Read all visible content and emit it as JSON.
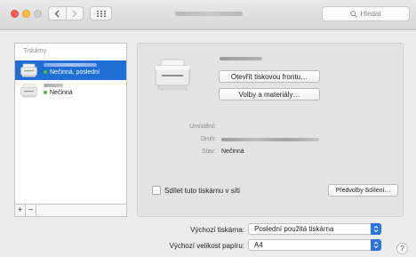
{
  "window": {
    "traffic_lights": {
      "close": "#fc605c",
      "minimize": "#fdbc40",
      "zoom": "#cfcfcf"
    },
    "back_icon": "chevron-left-icon",
    "forward_icon": "chevron-right-icon",
    "grid_icon": "grid-icon",
    "search": {
      "placeholder": "Hledat",
      "icon": "search-icon"
    }
  },
  "sidebar": {
    "header": "Tiskárny",
    "printers": [
      {
        "status": "Nečinná, poslední",
        "selected": true
      },
      {
        "status": "Nečinná",
        "selected": false
      }
    ],
    "add_label": "+",
    "remove_label": "−"
  },
  "detail": {
    "open_queue_button": "Otevřít tiskovou frontu…",
    "options_button": "Volby a materiály…",
    "location_label": "Umístění:",
    "location_value": "",
    "type_label": "Druh:",
    "status_label": "Stav:",
    "status_value": "Nečinná",
    "share_checkbox_label": "Sdílet tuto tiskárnu v síti",
    "share_checked": false,
    "sharing_prefs_button": "Předvolby Sdílení…"
  },
  "bottom": {
    "default_printer_label": "Výchozí tiskárna:",
    "default_printer_value": "Poslední použitá tiskárna",
    "paper_size_label": "Výchozí velikost papíru:",
    "paper_size_value": "A4",
    "help_label": "?"
  },
  "colors": {
    "accent": "#2b73e0",
    "selection": "#1f6ed6",
    "status_green": "#3fbf3f"
  }
}
